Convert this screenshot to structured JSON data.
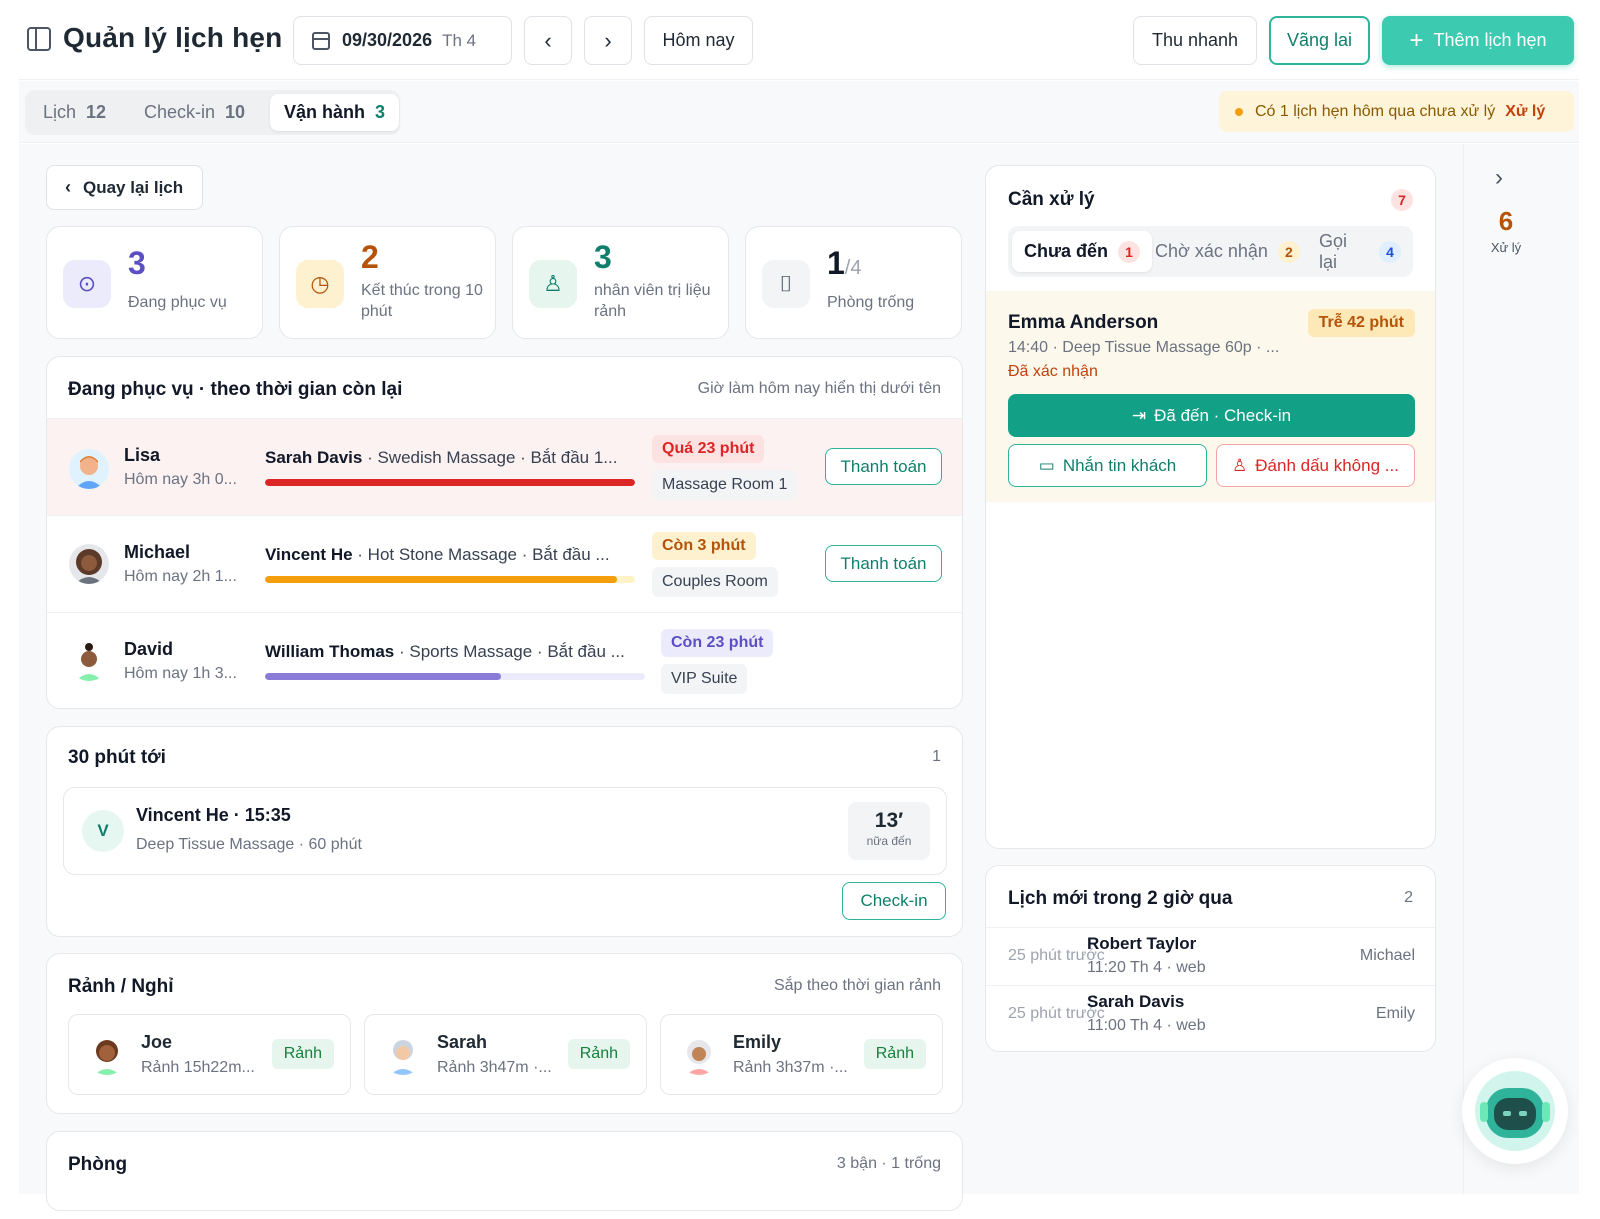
{
  "header": {
    "title": "Quản lý lịch hẹn",
    "date": "09/30/2026",
    "dow": "Th 4",
    "prev": "‹",
    "next": "›",
    "today": "Hôm nay",
    "quick_checkout": "Thu nhanh",
    "walk_in": "Vãng lai",
    "add": "Thêm lịch hẹn"
  },
  "tabs": [
    {
      "label": "Lịch",
      "count": "12"
    },
    {
      "label": "Check-in",
      "count": "10"
    },
    {
      "label": "Vận hành",
      "count": "3",
      "active": true
    }
  ],
  "alert": {
    "text": "Có 1 lịch hẹn hôm qua chưa xử lý",
    "action": "Xử lý"
  },
  "back": "Quay lại lịch",
  "stats": [
    {
      "value": "3",
      "label": "Đang phục vụ",
      "color": "#5b4fc4"
    },
    {
      "value": "2",
      "label": "Kết thúc trong 10 phút",
      "color": "#b45309"
    },
    {
      "value": "3",
      "label": "nhân viên trị liệu rảnh",
      "color": "#0f7f6c"
    },
    {
      "value": "1",
      "sub": "/4",
      "label": "Phòng trống",
      "color": "#111827"
    }
  ],
  "serving": {
    "title": "Đang phục vụ · theo thời gian còn lại",
    "note": "Giờ làm hôm nay hiển thị dưới tên",
    "rows": [
      {
        "staff": "Lisa",
        "hours": "Hôm nay 3h 0...",
        "client": "Sarah Davis",
        "service": " · Swedish Massage · Bắt đầu 1...",
        "status": "Quá 23 phút",
        "room": "Massage Room 1",
        "pay": "Thanh toán",
        "progress": 1.0,
        "color": "#dc2626"
      },
      {
        "staff": "Michael",
        "hours": "Hôm nay 2h 1...",
        "client": "Vincent He",
        "service": " · Hot Stone Massage · Bắt đầu ...",
        "status": "Còn 3 phút",
        "room": "Couples Room",
        "pay": "Thanh toán",
        "progress": 0.95,
        "color": "#f59e0b"
      },
      {
        "staff": "David",
        "hours": "Hôm nay 1h 3...",
        "client": "William Thomas",
        "service": " · Sports Massage · Bắt đầu ...",
        "status": "Còn 23 phút",
        "room": "VIP Suite",
        "pay": "",
        "progress": 0.62,
        "color": "#8b7bd8"
      }
    ]
  },
  "upcoming": {
    "title": "30 phút tới",
    "count": "1",
    "initial": "V",
    "name_time": "Vincent He · 15:35",
    "service": "Deep Tissue Massage · 60 phút",
    "minutes": "13′",
    "minutes_label": "nữa đến",
    "checkin": "Check-in"
  },
  "free": {
    "title": "Rảnh / Nghỉ",
    "note": "Sắp theo thời gian rảnh",
    "items": [
      {
        "name": "Joe",
        "sub": "Rảnh 15h22m...",
        "badge": "Rảnh"
      },
      {
        "name": "Sarah",
        "sub": "Rảnh 3h47m ·...",
        "badge": "Rảnh"
      },
      {
        "name": "Emily",
        "sub": "Rảnh 3h37m ·...",
        "badge": "Rảnh"
      }
    ]
  },
  "rooms": {
    "title": "Phòng",
    "note": "3 bận · 1 trống"
  },
  "handle": {
    "title": "Cần xử lý",
    "count": "7",
    "tabs": [
      {
        "label": "Chưa đến",
        "count": "1"
      },
      {
        "label": "Chờ xác nhận",
        "count": "2"
      },
      {
        "label": "Gọi lại",
        "count": "4"
      }
    ],
    "item": {
      "name": "Emma Anderson",
      "detail": "14:40 · Deep Tissue Massage 60p · ...",
      "status": "Đã xác nhận",
      "late": "Trễ 42 phút",
      "arrive": "Đã đến · Check-in",
      "message": "Nhắn tin khách",
      "noshow": "Đánh dấu không ..."
    }
  },
  "recent": {
    "title": "Lịch mới trong 2 giờ qua",
    "count": "2",
    "rows": [
      {
        "ago": "25 phút trước",
        "name": "Robert Taylor",
        "when": "11:20 Th 4 · web",
        "staff": "Michael"
      },
      {
        "ago": "25 phút trước",
        "name": "Sarah Davis",
        "when": "11:00 Th 4 · web",
        "staff": "Emily"
      }
    ]
  },
  "rail": {
    "count": "6",
    "label": "Xử lý"
  }
}
